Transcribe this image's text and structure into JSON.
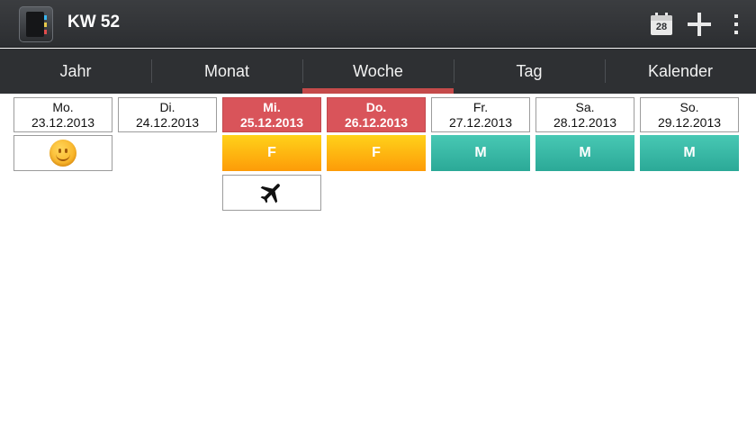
{
  "header": {
    "title": "KW 52"
  },
  "actions": {
    "calendar_day": "28"
  },
  "tabs": [
    {
      "label": "Jahr"
    },
    {
      "label": "Monat"
    },
    {
      "label": "Woche",
      "active": true
    },
    {
      "label": "Tag"
    },
    {
      "label": "Kalender"
    }
  ],
  "days": [
    {
      "name": "Mo.",
      "date": "23.12.2013",
      "holiday": false
    },
    {
      "name": "Di.",
      "date": "24.12.2013",
      "holiday": false
    },
    {
      "name": "Mi.",
      "date": "25.12.2013",
      "holiday": true
    },
    {
      "name": "Do.",
      "date": "26.12.2013",
      "holiday": true
    },
    {
      "name": "Fr.",
      "date": "27.12.2013",
      "holiday": false
    },
    {
      "name": "Sa.",
      "date": "28.12.2013",
      "holiday": false
    },
    {
      "name": "So.",
      "date": "29.12.2013",
      "holiday": false
    }
  ],
  "shifts": {
    "mo": {
      "icon": "smiley-icon"
    },
    "mi": {
      "label": "F",
      "color": "#fdb211"
    },
    "do": {
      "label": "F",
      "color": "#fdb211"
    },
    "fr": {
      "label": "M",
      "color": "#36b8a5"
    },
    "sa": {
      "label": "M",
      "color": "#36b8a5"
    },
    "so": {
      "label": "M",
      "color": "#36b8a5"
    }
  },
  "notes": {
    "mi": {
      "icon": "airplane-icon"
    }
  },
  "colors": {
    "holiday_header": "#d9545a",
    "active_tab_indicator": "#c54a4a"
  }
}
